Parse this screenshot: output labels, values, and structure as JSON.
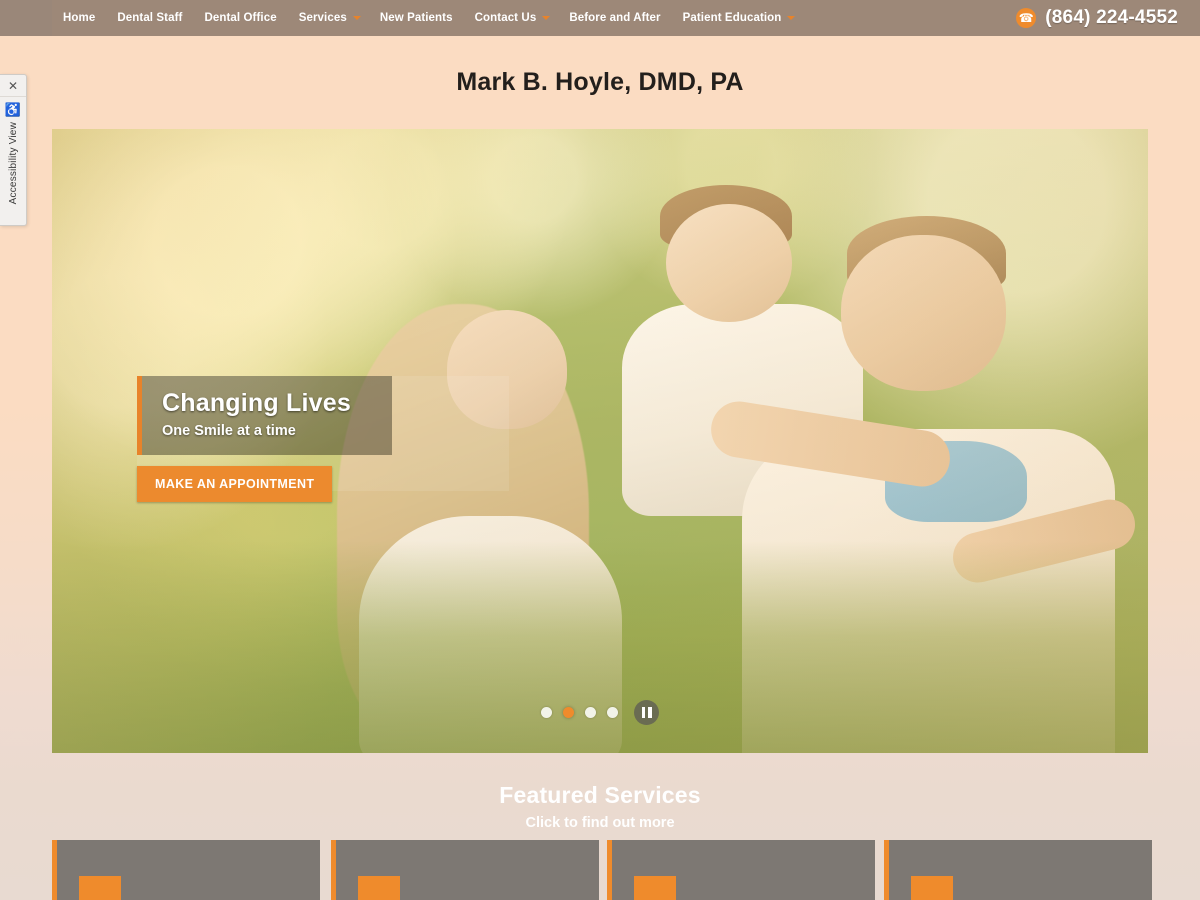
{
  "nav": {
    "items": [
      {
        "label": "Home",
        "caret": false
      },
      {
        "label": "Dental Staff",
        "caret": false
      },
      {
        "label": "Dental Office",
        "caret": false
      },
      {
        "label": "Services",
        "caret": true
      },
      {
        "label": "New Patients",
        "caret": false
      },
      {
        "label": "Contact Us",
        "caret": true
      },
      {
        "label": "Before and After",
        "caret": false
      },
      {
        "label": "Patient Education",
        "caret": true
      }
    ],
    "phone": "(864) 224-4552",
    "phone_icon": "phone-icon"
  },
  "accessibility": {
    "close_label": "✕",
    "icon": "wheelchair-icon",
    "icon_glyph": "♿",
    "label": "Accessibility View"
  },
  "header": {
    "title": "Mark B. Hoyle, DMD, PA"
  },
  "hero": {
    "caption_title": "Changing Lives",
    "caption_sub": "One Smile at a time",
    "cta_label": "MAKE AN APPOINTMENT",
    "slides_total": 4,
    "active_slide": 2,
    "pause_label": "pause-icon"
  },
  "featured": {
    "title": "Featured Services",
    "subtitle": "Click to find out more"
  },
  "cards": [
    {
      "icon": "tooth-icon",
      "glyph": "■"
    },
    {
      "icon": "teeth-icon",
      "glyph": "■"
    },
    {
      "icon": "implant-icon",
      "glyph": "■"
    },
    {
      "icon": "smile-icon",
      "glyph": "■"
    }
  ],
  "colors": {
    "nav_bg": "#9d8878",
    "accent_orange": "#ef8b2c",
    "page_bg_top": "#fbdcc2",
    "page_bg_bottom": "#e8dad1",
    "card_bg": "#7d7873"
  }
}
